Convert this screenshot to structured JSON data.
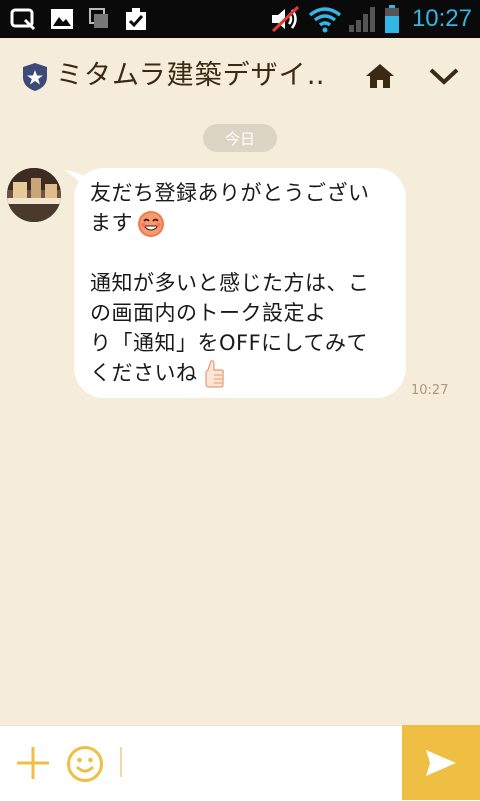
{
  "status_bar": {
    "time": "10:27",
    "icons": [
      "q-app-icon",
      "gallery-icon",
      "sd-card-icon",
      "clipboard-check-icon",
      "volume-muted-icon",
      "wifi-icon",
      "signal-icon",
      "battery-icon"
    ],
    "time_color": "#33b5e5"
  },
  "header": {
    "title": "ミタムラ建築デザイ…",
    "shield_icon": "shield-star-icon",
    "home_icon": "home-icon",
    "menu_icon": "chevron-down-icon"
  },
  "chat": {
    "date_label": "今日",
    "message": {
      "line1": "友だち登録ありがとうござい",
      "line2": "ます",
      "line3": "通知が多いと感じた方は、こ",
      "line4": "の画面内のトーク設定よ",
      "line5": "り「通知」をOFFにしてみて",
      "line6": "くださいね",
      "time": "10:27"
    }
  },
  "input_bar": {
    "placeholder": "",
    "plus_icon": "plus-icon",
    "emoji_icon": "smiley-icon",
    "send_icon": "send-icon"
  },
  "colors": {
    "background": "#f5ecd9",
    "accent": "#eebf42",
    "bubble": "#ffffff",
    "title_text": "#3a2a14"
  }
}
